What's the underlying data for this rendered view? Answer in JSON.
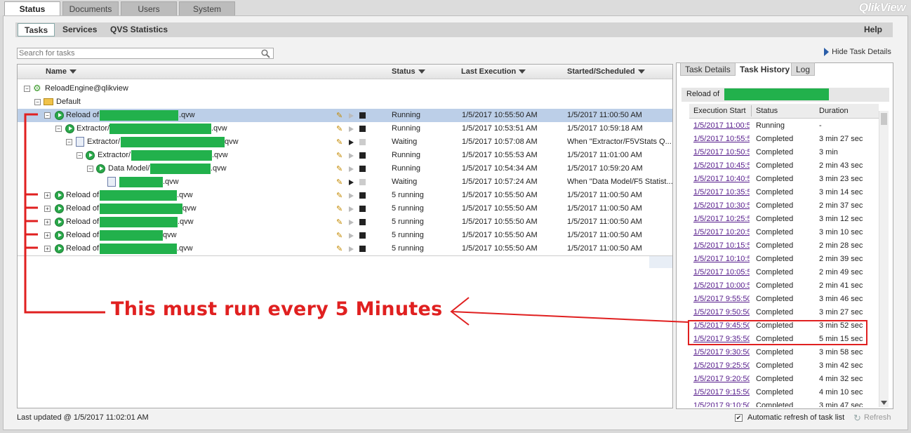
{
  "top_tabs": [
    "Status",
    "Documents",
    "Users",
    "System"
  ],
  "brand": "QlikView",
  "sub_tabs": [
    "Tasks",
    "Services",
    "QVS Statistics"
  ],
  "help_label": "Help",
  "search": {
    "placeholder": "Search for tasks"
  },
  "hide_details_label": "Hide Task Details",
  "tree": {
    "columns": [
      "Name",
      "Status",
      "Last Execution",
      "Started/Scheduled"
    ],
    "root": "ReloadEngine@qlikview",
    "folder": "Default",
    "rows": [
      {
        "prefix": "Reload of",
        "suffix": ".qvw",
        "status": "Running",
        "last": "1/5/2017 10:55:50 AM",
        "scheduled": "1/5/2017 11:00:50 AM"
      },
      {
        "prefix": "Extractor/",
        "suffix": ".qvw",
        "status": "Running",
        "last": "1/5/2017 10:53:51 AM",
        "scheduled": "1/5/2017 10:59:18 AM"
      },
      {
        "prefix": "Extractor/",
        "suffix": "qvw",
        "status": "Waiting",
        "last": "1/5/2017 10:57:08 AM",
        "scheduled": "When \"Extractor/F5VStats Q..."
      },
      {
        "prefix": "Extractor/",
        "suffix": ".qvw",
        "status": "Running",
        "last": "1/5/2017 10:55:53 AM",
        "scheduled": "1/5/2017 11:01:00 AM"
      },
      {
        "prefix": "Data Model/",
        "suffix": ".qvw",
        "status": "Running",
        "last": "1/5/2017 10:54:34 AM",
        "scheduled": "1/5/2017 10:59:20 AM"
      },
      {
        "prefix": "",
        "suffix": ".qvw",
        "status": "Waiting",
        "last": "1/5/2017 10:57:24 AM",
        "scheduled": "When \"Data Model/F5 Statist..."
      },
      {
        "prefix": "Reload of",
        "suffix": ".qvw",
        "status": "5 running",
        "last": "1/5/2017 10:55:50 AM",
        "scheduled": "1/5/2017 11:00:50 AM"
      },
      {
        "prefix": "Reload of",
        "suffix": "qvw",
        "status": "5 running",
        "last": "1/5/2017 10:55:50 AM",
        "scheduled": "1/5/2017 11:00:50 AM"
      },
      {
        "prefix": "Reload of",
        "suffix": ".qvw",
        "status": "5 running",
        "last": "1/5/2017 10:55:50 AM",
        "scheduled": "1/5/2017 11:00:50 AM"
      },
      {
        "prefix": "Reload of",
        "suffix": "qvw",
        "status": "5 running",
        "last": "1/5/2017 10:55:50 AM",
        "scheduled": "1/5/2017 11:00:50 AM"
      },
      {
        "prefix": "Reload of",
        "suffix": ".qvw",
        "status": "5 running",
        "last": "1/5/2017 10:55:50 AM",
        "scheduled": "1/5/2017 11:00:50 AM"
      }
    ]
  },
  "right_tabs": [
    "Task Details",
    "Task History",
    "Log"
  ],
  "reload_header": "Reload of",
  "history": {
    "columns": [
      "Execution Start",
      "Status",
      "Duration"
    ],
    "rows": [
      {
        "start": "1/5/2017 11:00:5",
        "status": "Running",
        "duration": "-"
      },
      {
        "start": "1/5/2017 10:55:5",
        "status": "Completed",
        "duration": "3 min 27 sec"
      },
      {
        "start": "1/5/2017 10:50:5",
        "status": "Completed",
        "duration": "3 min"
      },
      {
        "start": "1/5/2017 10:45:5",
        "status": "Completed",
        "duration": "2 min 43 sec"
      },
      {
        "start": "1/5/2017 10:40:5",
        "status": "Completed",
        "duration": "3 min 23 sec"
      },
      {
        "start": "1/5/2017 10:35:5",
        "status": "Completed",
        "duration": "3 min 14 sec"
      },
      {
        "start": "1/5/2017 10:30:5",
        "status": "Completed",
        "duration": "2 min 37 sec"
      },
      {
        "start": "1/5/2017 10:25:5",
        "status": "Completed",
        "duration": "3 min 12 sec"
      },
      {
        "start": "1/5/2017 10:20:5",
        "status": "Completed",
        "duration": "3 min 10 sec"
      },
      {
        "start": "1/5/2017 10:15:5",
        "status": "Completed",
        "duration": "2 min 28 sec"
      },
      {
        "start": "1/5/2017 10:10:5",
        "status": "Completed",
        "duration": "2 min 39 sec"
      },
      {
        "start": "1/5/2017 10:05:5",
        "status": "Completed",
        "duration": "2 min 49 sec"
      },
      {
        "start": "1/5/2017 10:00:5",
        "status": "Completed",
        "duration": "2 min 41 sec"
      },
      {
        "start": "1/5/2017 9:55:50",
        "status": "Completed",
        "duration": "3 min 46 sec"
      },
      {
        "start": "1/5/2017 9:50:50",
        "status": "Completed",
        "duration": "3 min 27 sec"
      },
      {
        "start": "1/5/2017 9:45:50",
        "status": "Completed",
        "duration": "3 min 52 sec"
      },
      {
        "start": "1/5/2017 9:35:50",
        "status": "Completed",
        "duration": "5 min 15 sec"
      },
      {
        "start": "1/5/2017 9:30:50",
        "status": "Completed",
        "duration": "3 min 58 sec"
      },
      {
        "start": "1/5/2017 9:25:50",
        "status": "Completed",
        "duration": "3 min 42 sec"
      },
      {
        "start": "1/5/2017 9:20:50",
        "status": "Completed",
        "duration": "4 min 32 sec"
      },
      {
        "start": "1/5/2017 9:15:50",
        "status": "Completed",
        "duration": "4 min 10 sec"
      },
      {
        "start": "1/5/2017 9:10:50",
        "status": "Completed",
        "duration": "3 min 47 sec"
      }
    ]
  },
  "annotation": "This must run every 5 Minutes",
  "footer": {
    "last_updated": "Last updated @ 1/5/2017 11:02:01 AM",
    "auto_refresh": "Automatic refresh of task list",
    "refresh": "Refresh"
  },
  "colors": {
    "annotation_red": "#e02020",
    "redacted_green": "#22b14c",
    "selected_row": "#bccfe8",
    "running_icon": "#2aa84a"
  },
  "icons": [
    "gear-icon",
    "folder-icon",
    "play-icon",
    "pencil-icon",
    "run-icon",
    "stop-icon",
    "document-icon",
    "search-icon",
    "funnel-icon",
    "refresh-icon"
  ]
}
